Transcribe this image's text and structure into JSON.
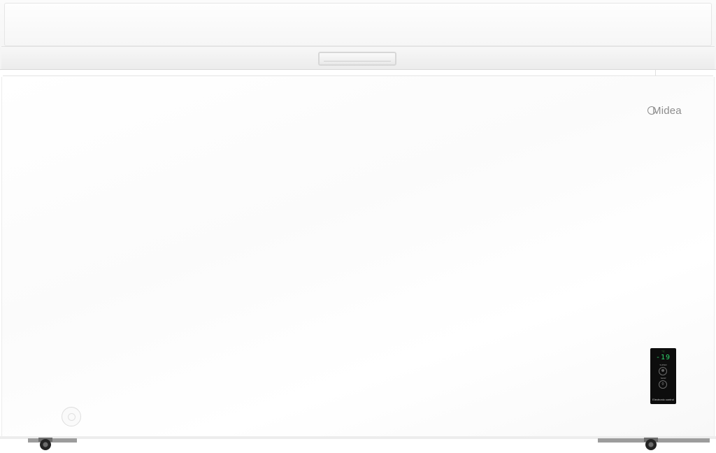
{
  "brand": {
    "logo_text": "Midea"
  },
  "control_panel": {
    "temperature_display": "-19",
    "top_indicator": "°C",
    "button_super": "❄",
    "label_super": "SUPER",
    "button_temp": "◊",
    "label_temp": "TEMP",
    "footer_label": "Electronic control",
    "display_color": "#31d46a"
  },
  "colors": {
    "body": "#ffffff",
    "panel": "#0d0d0d"
  }
}
